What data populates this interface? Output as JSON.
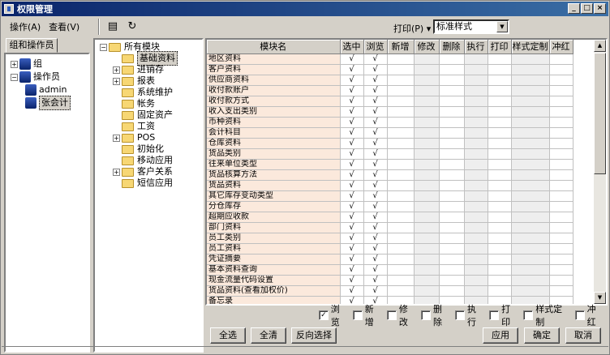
{
  "window": {
    "title": "权限管理"
  },
  "menu": {
    "action": "操作(A)",
    "view": "查看(V)"
  },
  "toolbar": {
    "print_label": "打印(P)",
    "print_style": "标准样式"
  },
  "left_panel": {
    "tab": "组和操作员",
    "tree": [
      {
        "label": "组",
        "level": 0,
        "expander": "+"
      },
      {
        "label": "操作员",
        "level": 0,
        "expander": "-"
      },
      {
        "label": "admin",
        "level": 1,
        "expander": ""
      },
      {
        "label": "张会计",
        "level": 1,
        "expander": "",
        "selected": true
      }
    ]
  },
  "module_tree": [
    {
      "label": "所有模块",
      "level": 0,
      "expander": "-"
    },
    {
      "label": "基础资料",
      "level": 1,
      "expander": "",
      "selected": true
    },
    {
      "label": "进销存",
      "level": 1,
      "expander": "+"
    },
    {
      "label": "报表",
      "level": 1,
      "expander": "+"
    },
    {
      "label": "系统维护",
      "level": 1,
      "expander": ""
    },
    {
      "label": "帐务",
      "level": 1,
      "expander": ""
    },
    {
      "label": "固定资产",
      "level": 1,
      "expander": ""
    },
    {
      "label": "工资",
      "level": 1,
      "expander": ""
    },
    {
      "label": "POS",
      "level": 1,
      "expander": "+"
    },
    {
      "label": "初始化",
      "level": 1,
      "expander": ""
    },
    {
      "label": "移动应用",
      "level": 1,
      "expander": ""
    },
    {
      "label": "客户关系",
      "level": 1,
      "expander": "+"
    },
    {
      "label": "短信应用",
      "level": 1,
      "expander": ""
    }
  ],
  "grid": {
    "columns": [
      "模块名",
      "选中",
      "浏览",
      "新增",
      "修改",
      "删除",
      "执行",
      "打印",
      "样式定制",
      "冲红"
    ],
    "check_glyph": "√",
    "rows": [
      {
        "name": "地区资料",
        "select": true,
        "browse": true
      },
      {
        "name": "客户资料",
        "select": true,
        "browse": true
      },
      {
        "name": "供应商资料",
        "select": true,
        "browse": true
      },
      {
        "name": "收付款账户",
        "select": true,
        "browse": true
      },
      {
        "name": "收付款方式",
        "select": true,
        "browse": true
      },
      {
        "name": "收入支出类别",
        "select": true,
        "browse": true
      },
      {
        "name": "币种资料",
        "select": true,
        "browse": true
      },
      {
        "name": "会计科目",
        "select": true,
        "browse": true
      },
      {
        "name": "仓库资料",
        "select": true,
        "browse": true
      },
      {
        "name": "货品类别",
        "select": true,
        "browse": true
      },
      {
        "name": "往来单位类型",
        "select": true,
        "browse": true
      },
      {
        "name": "货品核算方法",
        "select": true,
        "browse": true
      },
      {
        "name": "货品资料",
        "select": true,
        "browse": true
      },
      {
        "name": "其它库存变动类型",
        "select": true,
        "browse": true
      },
      {
        "name": "分仓库存",
        "select": true,
        "browse": true
      },
      {
        "name": "超期应收款",
        "select": true,
        "browse": true
      },
      {
        "name": "部门资料",
        "select": true,
        "browse": true
      },
      {
        "name": "员工类别",
        "select": true,
        "browse": true
      },
      {
        "name": "员工资料",
        "select": true,
        "browse": true
      },
      {
        "name": "凭证摘要",
        "select": true,
        "browse": true
      },
      {
        "name": "基本资料查询",
        "select": true,
        "browse": true
      },
      {
        "name": "现金流量代码设置",
        "select": true,
        "browse": true
      },
      {
        "name": "货品资料(查看加权价)",
        "select": true,
        "browse": true
      },
      {
        "name": "备忘录",
        "select": true,
        "browse": true
      }
    ]
  },
  "bottom_checks": [
    {
      "label": "浏览",
      "checked": true
    },
    {
      "label": "新增",
      "checked": false
    },
    {
      "label": "修改",
      "checked": false
    },
    {
      "label": "删除",
      "checked": false
    },
    {
      "label": "执行",
      "checked": false
    },
    {
      "label": "打印",
      "checked": false
    },
    {
      "label": "样式定制",
      "checked": false
    },
    {
      "label": "冲红",
      "checked": false
    }
  ],
  "buttons": {
    "select_all": "全选",
    "clear_all": "全清",
    "invert": "反向选择",
    "apply": "应用",
    "ok": "确定",
    "cancel": "取消"
  }
}
